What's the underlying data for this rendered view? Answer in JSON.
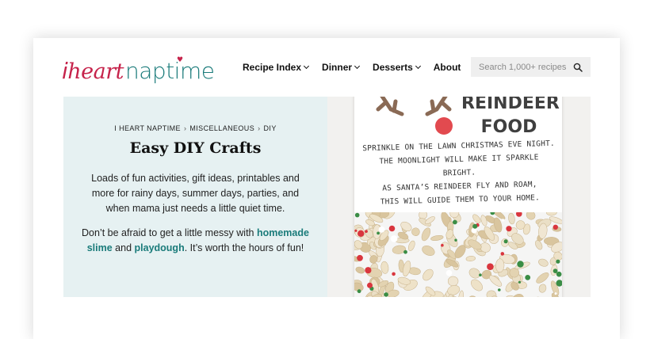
{
  "brand": {
    "logo_i": "i",
    "logo_heart": "heart",
    "logo_naptime": "naptime"
  },
  "nav": {
    "items": [
      {
        "label": "Recipe Index",
        "dropdown": true
      },
      {
        "label": "Dinner",
        "dropdown": true
      },
      {
        "label": "Desserts",
        "dropdown": true
      },
      {
        "label": "About",
        "dropdown": false
      }
    ]
  },
  "search": {
    "placeholder": "Search 1,000+ recipes",
    "icon": "search-icon"
  },
  "breadcrumb": {
    "items": [
      "I HEART NAPTIME",
      "MISCELLANEOUS",
      "DIY"
    ],
    "separator": "›"
  },
  "hero": {
    "title": "Easy DIY Crafts",
    "paragraph1": "Loads of fun activities, gift ideas, printables and more for rainy days, summer days, parties, and when mama just needs a little quiet time.",
    "p2_before": "Don’t be afraid to get a little messy with ",
    "p2_link1": "homemade slime",
    "p2_and": " and ",
    "p2_link2": "playdough",
    "p2_after": ". It’s worth the hours of fun!"
  },
  "image": {
    "card_title_line1": "REINDEER",
    "card_title_line2": "FOOD",
    "poem": [
      "Sprinkle on the lawn Christmas Eve night.",
      "The moonlight will make it sparkle bright.",
      "As Santa’s reindeer fly and roam,",
      "this will guide them to your home."
    ]
  },
  "colors": {
    "brand_pink": "#c6234b",
    "brand_teal": "#1a7b7a",
    "hero_bg": "#e6f1f2",
    "search_bg": "#efefef"
  }
}
